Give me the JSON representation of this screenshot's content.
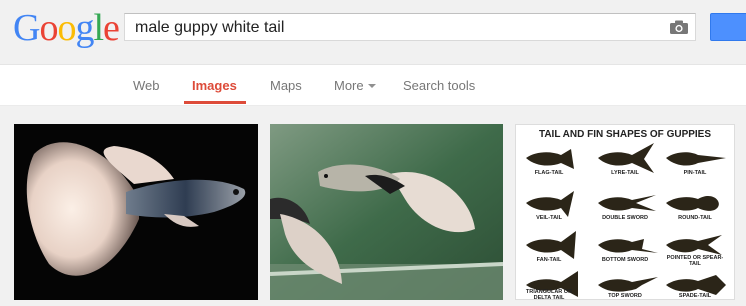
{
  "logo": {
    "letters": [
      "G",
      "o",
      "o",
      "g",
      "l",
      "e"
    ],
    "colors": [
      "#4285f4",
      "#ea4335",
      "#fbbc05",
      "#4285f4",
      "#34a853",
      "#ea4335"
    ]
  },
  "search": {
    "query": "male guppy white tail"
  },
  "nav": {
    "tabs": [
      {
        "label": "Web",
        "active": false
      },
      {
        "label": "Images",
        "active": true
      },
      {
        "label": "Maps",
        "active": false
      },
      {
        "label": "More",
        "active": false
      },
      {
        "label": "Search tools",
        "active": false
      }
    ]
  },
  "results": {
    "chart_image": {
      "title": "TAIL AND FIN SHAPES OF GUPPIES",
      "labels": [
        "FLAG-TAIL",
        "LYRE-TAIL",
        "PIN-TAIL",
        "VEIL-TAIL",
        "DOUBLE SWORD",
        "ROUND-TAIL",
        "FAN-TAIL",
        "BOTTOM SWORD",
        "POINTED OR SPEAR-TAIL",
        "TRIANGULAR OR DELTA TAIL",
        "TOP SWORD",
        "SPADE-TAIL"
      ]
    }
  },
  "colors": {
    "accent": "#dd4b39",
    "button": "#4d90fe"
  }
}
